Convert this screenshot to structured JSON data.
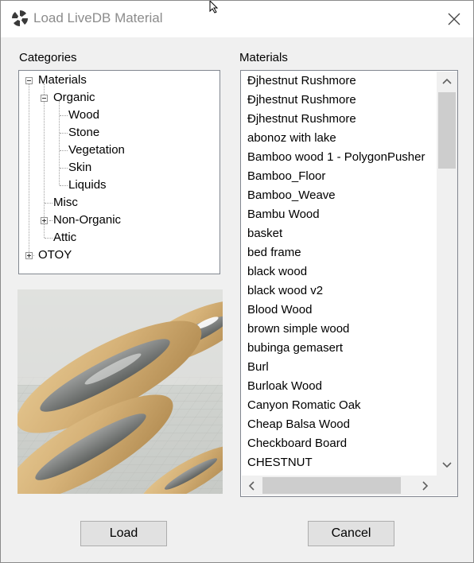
{
  "window": {
    "title": "Load LiveDB Material"
  },
  "categories": {
    "label": "Categories",
    "tree": [
      {
        "label": "Materials",
        "expander": "minus"
      },
      {
        "label": "Organic",
        "expander": "minus"
      },
      {
        "label": "Wood"
      },
      {
        "label": "Stone"
      },
      {
        "label": "Vegetation"
      },
      {
        "label": "Skin"
      },
      {
        "label": "Liquids"
      },
      {
        "label": "Misc"
      },
      {
        "label": "Non-Organic",
        "expander": "plus"
      },
      {
        "label": "Attic"
      },
      {
        "label": "OTOY",
        "expander": "plus"
      }
    ]
  },
  "materials": {
    "label": "Materials",
    "items": [
      "Ðjhestnut Rushmore",
      "Ðjhestnut Rushmore",
      "Ðjhestnut Rushmore",
      "abonoz with lake",
      "Bamboo wood 1 - PolygonPusher",
      "Bamboo_Floor",
      "Bamboo_Weave",
      "Bambu Wood",
      "basket",
      "bed frame",
      "black wood",
      "black wood v2",
      "Blood Wood",
      "brown simple wood",
      "bubinga gemasert",
      "Burl",
      "Burloak Wood",
      "Canyon Romatic Oak",
      "Cheap Balsa Wood",
      "Checkboard Board",
      "CHESTNUT"
    ]
  },
  "buttons": {
    "load": "Load",
    "cancel": "Cancel"
  },
  "icons": {
    "app": "octane-logo-icon",
    "close": "close-icon",
    "cursor": "mouse-cursor-icon",
    "scroll_up": "chevron-up-icon",
    "scroll_down": "chevron-down-icon",
    "scroll_left": "chevron-left-icon",
    "scroll_right": "chevron-right-icon"
  }
}
